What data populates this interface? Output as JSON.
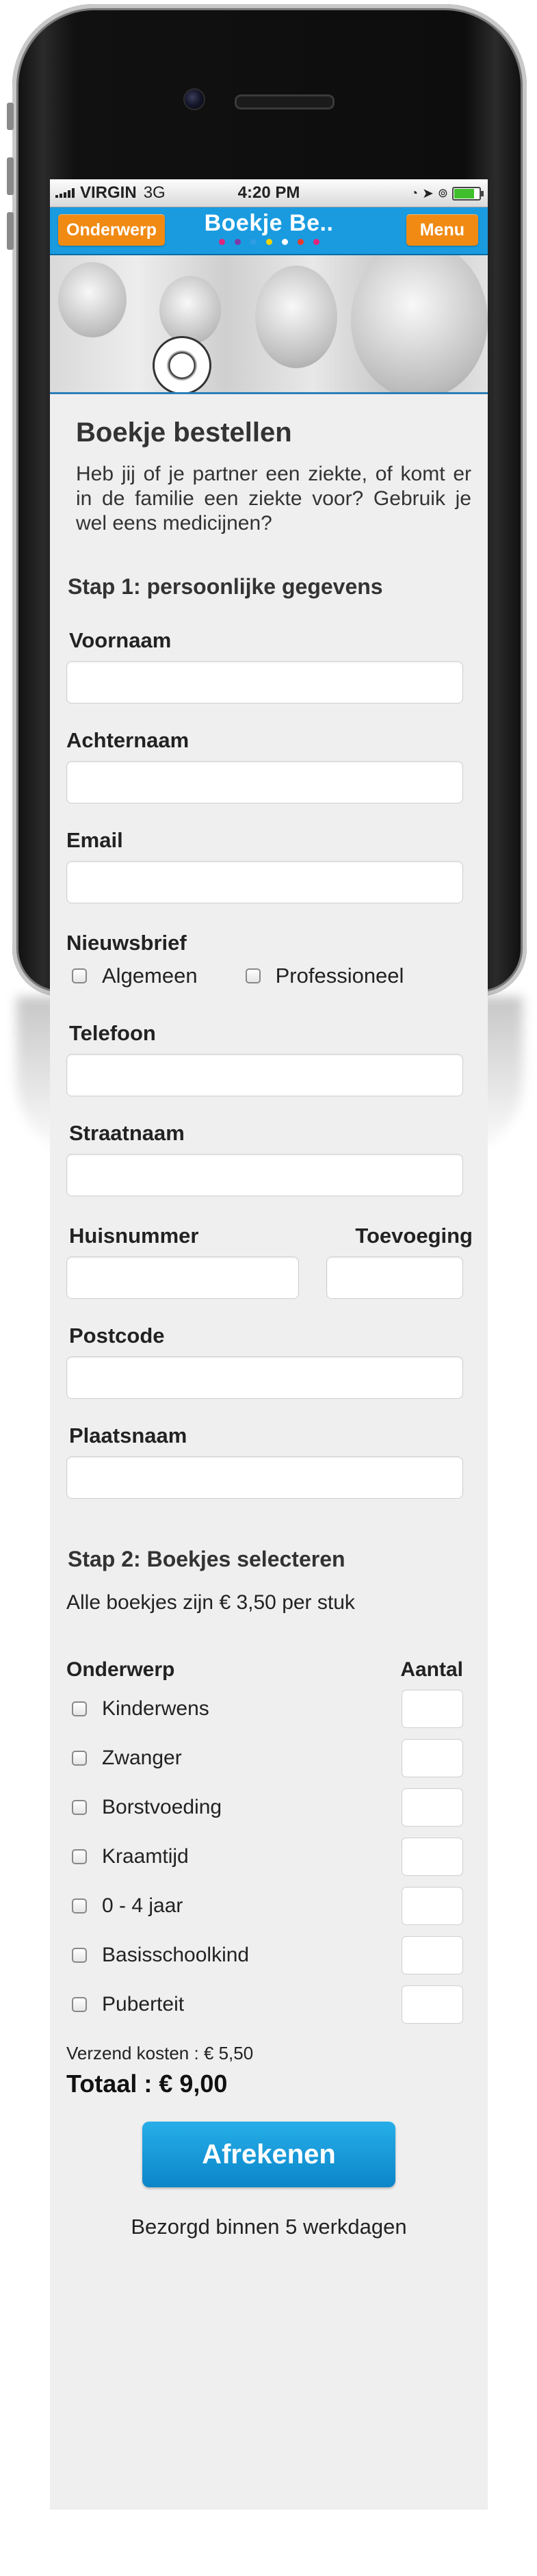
{
  "status_bar": {
    "carrier": "VIRGIN",
    "network": "3G",
    "time": "4:20 PM",
    "battery_level": 0.85
  },
  "header": {
    "left_button": "Onderwerp",
    "title": "Boekje Be..",
    "right_button": "Menu",
    "brand_colors": {
      "bar": "#1a9be0",
      "button": "#f08a13"
    },
    "dot_colors": [
      "#e0257d",
      "#7c3aa8",
      "#2e9de4",
      "#f5d400",
      "#ffffff",
      "#e63a2a",
      "#e0257d"
    ]
  },
  "page": {
    "title": "Boekje bestellen",
    "intro": "Heb jij of je partner een ziekte, of komt er in de familie een ziekte voor? Gebruik je wel eens medicijnen?"
  },
  "step1": {
    "heading": "Stap 1: persoonlijke gegevens",
    "fields": {
      "first_name": "Voornaam",
      "last_name": "Achternaam",
      "email": "Email",
      "newsletter": "Nieuwsbrief",
      "newsletter_general": "Algemeen",
      "newsletter_professional": "Professioneel",
      "phone": "Telefoon",
      "street": "Straatnaam",
      "house_number": "Huisnummer",
      "addition": "Toevoeging",
      "postcode": "Postcode",
      "city": "Plaatsnaam"
    }
  },
  "step2": {
    "heading": "Stap 2: Boekjes selecteren",
    "price_note": "Alle boekjes zijn  € 3,50 per stuk",
    "col_subject": "Onderwerp",
    "col_amount": "Aantal",
    "items": [
      {
        "label": "Kinderwens"
      },
      {
        "label": "Zwanger"
      },
      {
        "label": "Borstvoeding"
      },
      {
        "label": "Kraamtijd"
      },
      {
        "label": "0 - 4 jaar"
      },
      {
        "label": "Basisschoolkind"
      },
      {
        "label": "Puberteit"
      }
    ],
    "shipping": "Verzend kosten :  € 5,50",
    "total": "Totaal :  € 9,00",
    "checkout_button": "Afrekenen",
    "delivery_note": "Bezorgd binnen 5 werkdagen"
  }
}
